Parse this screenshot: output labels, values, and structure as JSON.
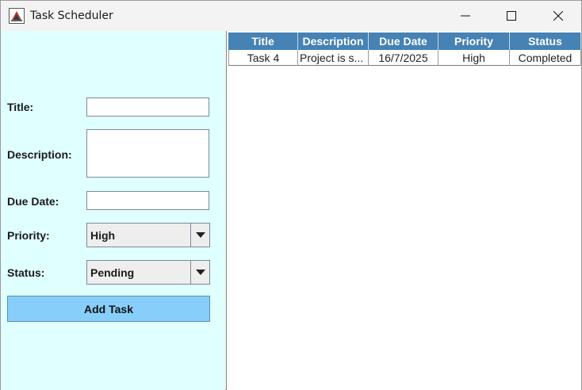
{
  "window": {
    "title": "Task Scheduler",
    "controls": {
      "minimize": "minimize-icon",
      "maximize": "maximize-icon",
      "close": "close-icon"
    }
  },
  "form": {
    "title_label": "Title:",
    "title_value": "",
    "description_label": "Description:",
    "description_value": "",
    "due_date_label": "Due Date:",
    "due_date_value": "",
    "priority_label": "Priority:",
    "priority_value": "High",
    "status_label": "Status:",
    "status_value": "Pending",
    "add_button": "Add Task"
  },
  "table": {
    "columns": [
      "Title",
      "Description",
      "Due Date",
      "Priority",
      "Status"
    ],
    "rows": [
      [
        "Task 4",
        "Project is s...",
        "16/7/2025",
        "High",
        "Completed"
      ]
    ]
  },
  "colors": {
    "left_panel": "#e0ffff",
    "header": "#4682b4",
    "button": "#87cefa"
  }
}
